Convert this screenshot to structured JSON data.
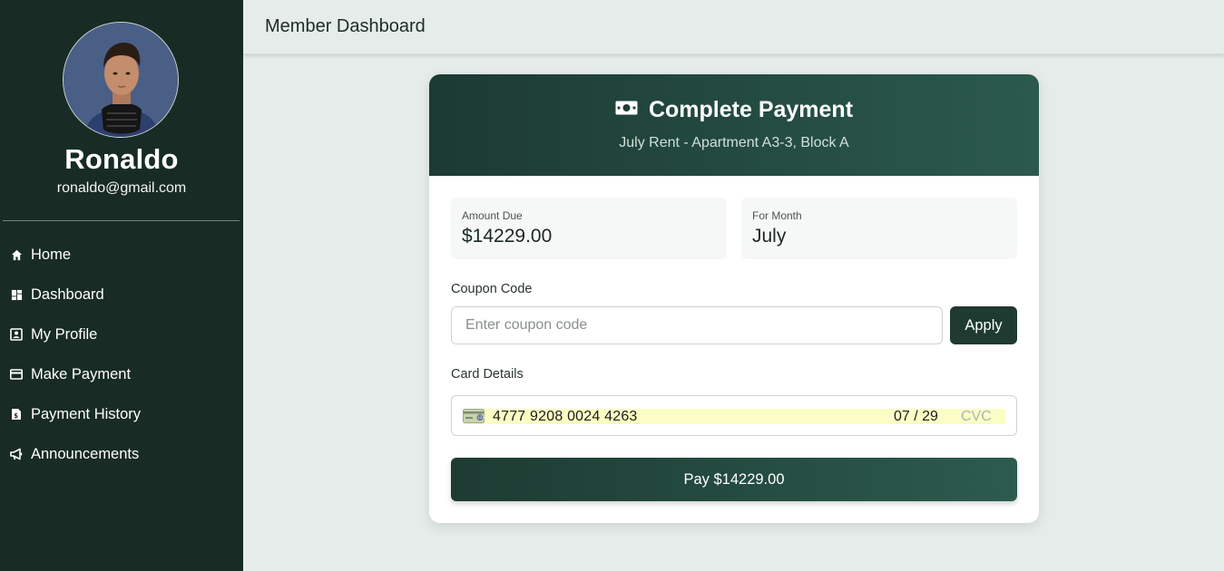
{
  "app": {
    "title": "Member Dashboard"
  },
  "user": {
    "name": "Ronaldo",
    "email": "ronaldo@gmail.com"
  },
  "sidebar": {
    "items": [
      {
        "label": "Home",
        "icon": "home-icon"
      },
      {
        "label": "Dashboard",
        "icon": "dashboard-icon"
      },
      {
        "label": "My Profile",
        "icon": "profile-icon"
      },
      {
        "label": "Make Payment",
        "icon": "credit-card-icon"
      },
      {
        "label": "Payment History",
        "icon": "history-icon"
      },
      {
        "label": "Announcements",
        "icon": "megaphone-icon"
      }
    ]
  },
  "payment": {
    "title": "Complete Payment",
    "title_icon": "money-icon",
    "subtitle": "July Rent - Apartment A3-3, Block A",
    "amount_due_label": "Amount Due",
    "amount_due_value": "$14229.00",
    "for_month_label": "For Month",
    "for_month_value": "July",
    "coupon_label": "Coupon Code",
    "coupon_placeholder": "Enter coupon code",
    "coupon_value": "",
    "apply_label": "Apply",
    "card_label": "Card Details",
    "card_number": "4777 9208 0024 4263",
    "card_expiry": "07 / 29",
    "card_cvc_placeholder": "CVC",
    "pay_label": "Pay $14229.00"
  },
  "colors": {
    "sidebar_bg": "#182b25",
    "accent": "#1e3a31",
    "page_bg": "#e5ecea",
    "autofill_bg": "#fbfdc4"
  }
}
